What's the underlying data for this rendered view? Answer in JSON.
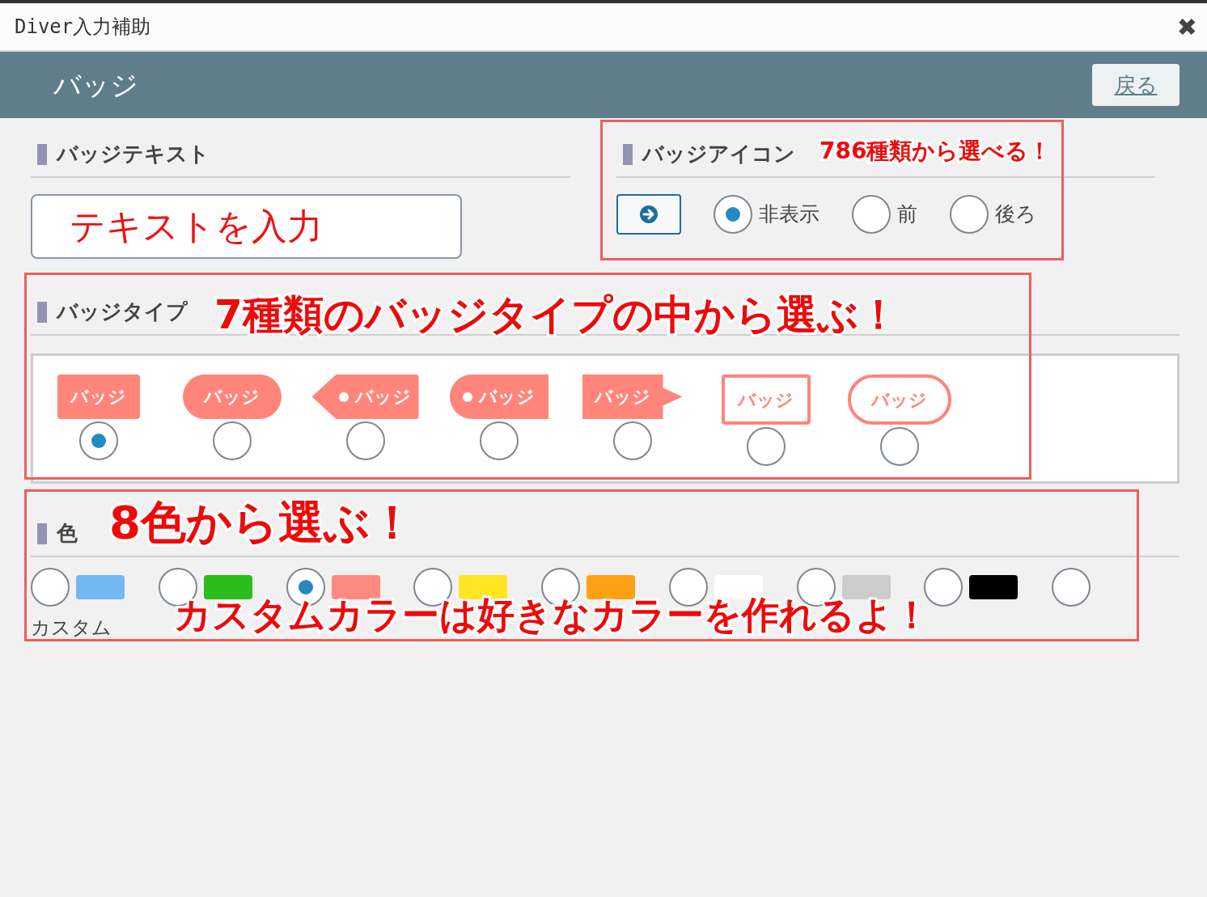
{
  "window": {
    "title": "Diver入力補助",
    "close": "✖"
  },
  "header": {
    "title": "バッジ",
    "back_button": "戻る"
  },
  "badge_text": {
    "heading": "バッジテキスト",
    "value": "テキストを入力"
  },
  "badge_icon": {
    "heading": "バッジアイコン",
    "positions": [
      {
        "label": "非表示",
        "selected": true
      },
      {
        "label": "前",
        "selected": false
      },
      {
        "label": "後ろ",
        "selected": false
      }
    ]
  },
  "badge_type": {
    "heading": "バッジタイプ",
    "types": [
      {
        "kind": "rect",
        "label": "バッジ",
        "selected": true
      },
      {
        "kind": "pill",
        "label": "バッジ",
        "selected": false
      },
      {
        "kind": "tag-left",
        "label": "バッジ",
        "selected": false
      },
      {
        "kind": "half-pill",
        "label": "バッジ",
        "selected": false
      },
      {
        "kind": "tag-right",
        "label": "バッジ",
        "selected": false
      },
      {
        "kind": "outline-rect",
        "label": "バッジ",
        "selected": false
      },
      {
        "kind": "outline-pill",
        "label": "バッジ",
        "selected": false
      }
    ]
  },
  "color": {
    "heading": "色",
    "custom_label": "カスタム",
    "swatches": [
      {
        "kind": "color",
        "color": "#72b8f2",
        "selected": false
      },
      {
        "kind": "color",
        "color": "#2bbd1b",
        "selected": false
      },
      {
        "kind": "color",
        "color": "#ff8a80",
        "selected": true
      },
      {
        "kind": "color",
        "color": "#ffe620",
        "selected": false
      },
      {
        "kind": "color",
        "color": "#ffa114",
        "selected": false
      },
      {
        "kind": "color",
        "color": "#ffffff",
        "selected": false
      },
      {
        "kind": "color",
        "color": "#cccccc",
        "selected": false
      },
      {
        "kind": "color",
        "color": "#000000",
        "selected": false
      },
      {
        "kind": "custom",
        "selected": false
      }
    ]
  },
  "annotations": [
    {
      "text": "786種類から選べる！"
    },
    {
      "text": "7種類のバッジタイプの中から選ぶ！"
    },
    {
      "text": "8色から選ぶ！"
    },
    {
      "text": "カスタムカラーは好きなカラーを作れるよ！"
    }
  ]
}
